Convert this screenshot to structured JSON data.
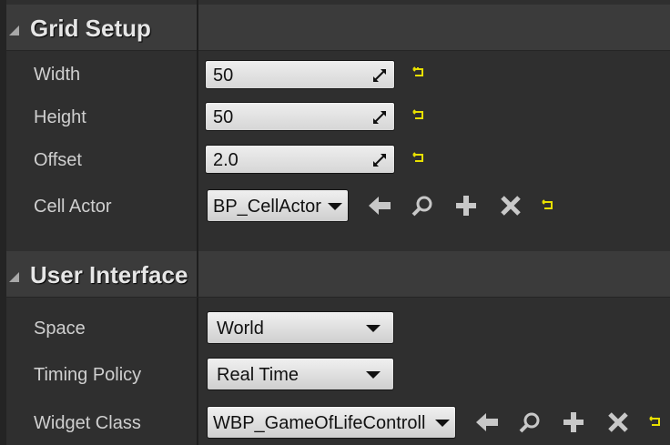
{
  "sections": [
    {
      "title": "Grid Setup",
      "rows": [
        {
          "label": "Width",
          "value": "50"
        },
        {
          "label": "Height",
          "value": "50"
        },
        {
          "label": "Offset",
          "value": "2.0"
        },
        {
          "label": "Cell Actor",
          "value": "BP_CellActor"
        }
      ]
    },
    {
      "title": "User Interface",
      "rows": [
        {
          "label": "Space",
          "value": "World"
        },
        {
          "label": "Timing Policy",
          "value": "Real Time"
        },
        {
          "label": "Widget Class",
          "value": "WBP_GameOfLifeControll"
        }
      ]
    }
  ],
  "icons": {
    "expand": "triangle-expanded-icon",
    "drag": "drag-arrows-icon",
    "reset": "reset-to-default-icon",
    "use_selected": "use-selected-arrow-icon",
    "browse": "magnifier-icon",
    "add": "plus-icon",
    "clear": "x-icon"
  },
  "colors": {
    "background": "#2f2f2f",
    "header": "#3b3b3b",
    "reset_accent": "#e8e000"
  }
}
